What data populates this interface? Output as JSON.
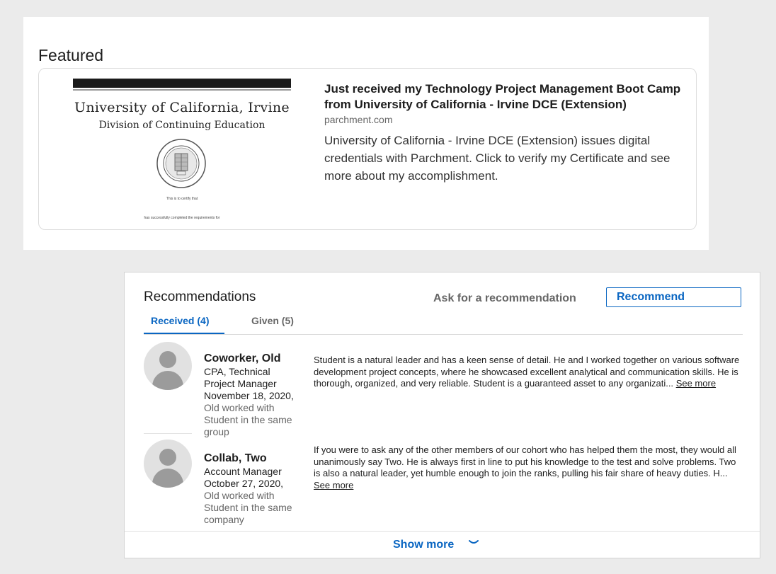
{
  "featured": {
    "title": "Featured",
    "item": {
      "thumbnail": {
        "university": "University of California, Irvine",
        "division": "Division of Continuing Education",
        "small_line_1": "This is to certify that",
        "small_line_2": "has successfully completed the requirements for"
      },
      "headline": "Just received my Technology Project Management Boot Camp from University of California - Irvine DCE (Extension)",
      "domain": "parchment.com",
      "description": "University of California - Irvine DCE (Extension) issues digital credentials with Parchment. Click to verify my Certificate and see more about my accomplishment."
    }
  },
  "recommendations": {
    "title": "Recommendations",
    "ask_label": "Ask for a recommendation",
    "recommend_button": "Recommend",
    "tabs": [
      {
        "label": "Received (4)",
        "active": true
      },
      {
        "label": "Given (5)",
        "active": false
      }
    ],
    "items": [
      {
        "name": "Coworker, Old",
        "role": "CPA, Technical Project Manager",
        "date": "November 18, 2020,",
        "relation": "Old worked with Student in the same group",
        "text": "Student is a natural leader and has a keen sense of detail. He and I worked together on various software development project concepts, where he showcased excellent analytical and communication skills. He is thorough, organized, and very reliable. Student is a guaranteed asset to any organizati...",
        "see_more": "See more"
      },
      {
        "name": "Collab, Two",
        "role": "Account Manager",
        "date": "October 27, 2020,",
        "relation": "Old worked with Student in the same company",
        "text": "If you were to ask any of the other members of our cohort who has helped them the most, they would all unanimously say Two. He is always first in line to put his knowledge to the test and solve problems. Two  is also a natural leader, yet humble enough to join the ranks, pulling his fair share of heavy duties. H...",
        "see_more": "See more"
      }
    ],
    "show_more": "Show more"
  },
  "colors": {
    "accent": "#0a66c2",
    "background": "#ebebeb",
    "card": "#ffffff",
    "muted_text": "#666666"
  }
}
